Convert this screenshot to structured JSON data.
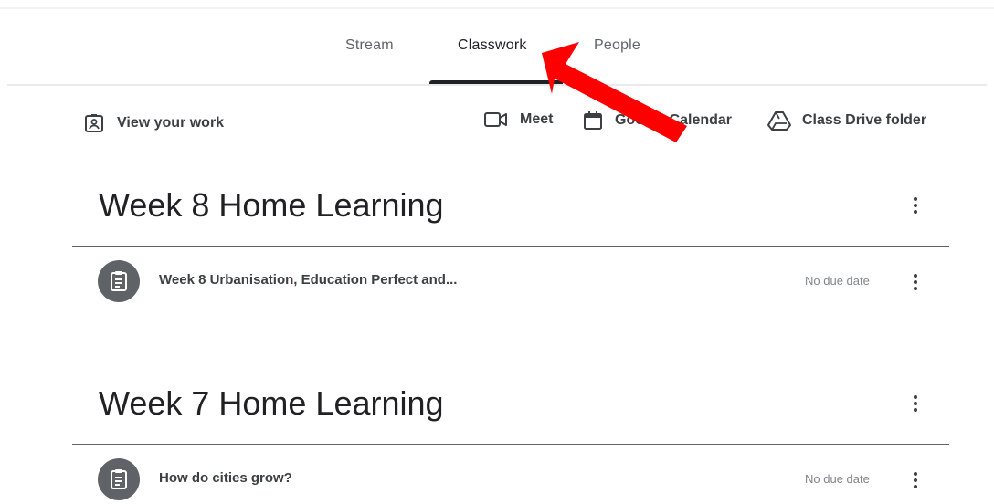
{
  "tabs": [
    {
      "label": "Stream",
      "active": false
    },
    {
      "label": "Classwork",
      "active": true
    },
    {
      "label": "People",
      "active": false
    }
  ],
  "toolbar": {
    "view_work": "View your work",
    "meet": "Meet",
    "calendar": "Google Calendar",
    "drive": "Class Drive folder"
  },
  "topics": [
    {
      "title": "Week 8 Home Learning",
      "items": [
        {
          "title": "Week 8 Urbanisation, Education Perfect and...",
          "due": "No due date",
          "icon": "assignment-icon"
        }
      ]
    },
    {
      "title": "Week 7 Home Learning",
      "items": [
        {
          "title": "How do cities grow?",
          "due": "No due date",
          "icon": "assignment-icon"
        }
      ]
    }
  ],
  "annotation": {
    "type": "red-arrow",
    "color": "#ff0000",
    "points_to": "Classwork"
  },
  "colors": {
    "accent": "#202124",
    "text": "#3c4043",
    "muted": "#5f6368",
    "arrow": "#ff0000"
  }
}
